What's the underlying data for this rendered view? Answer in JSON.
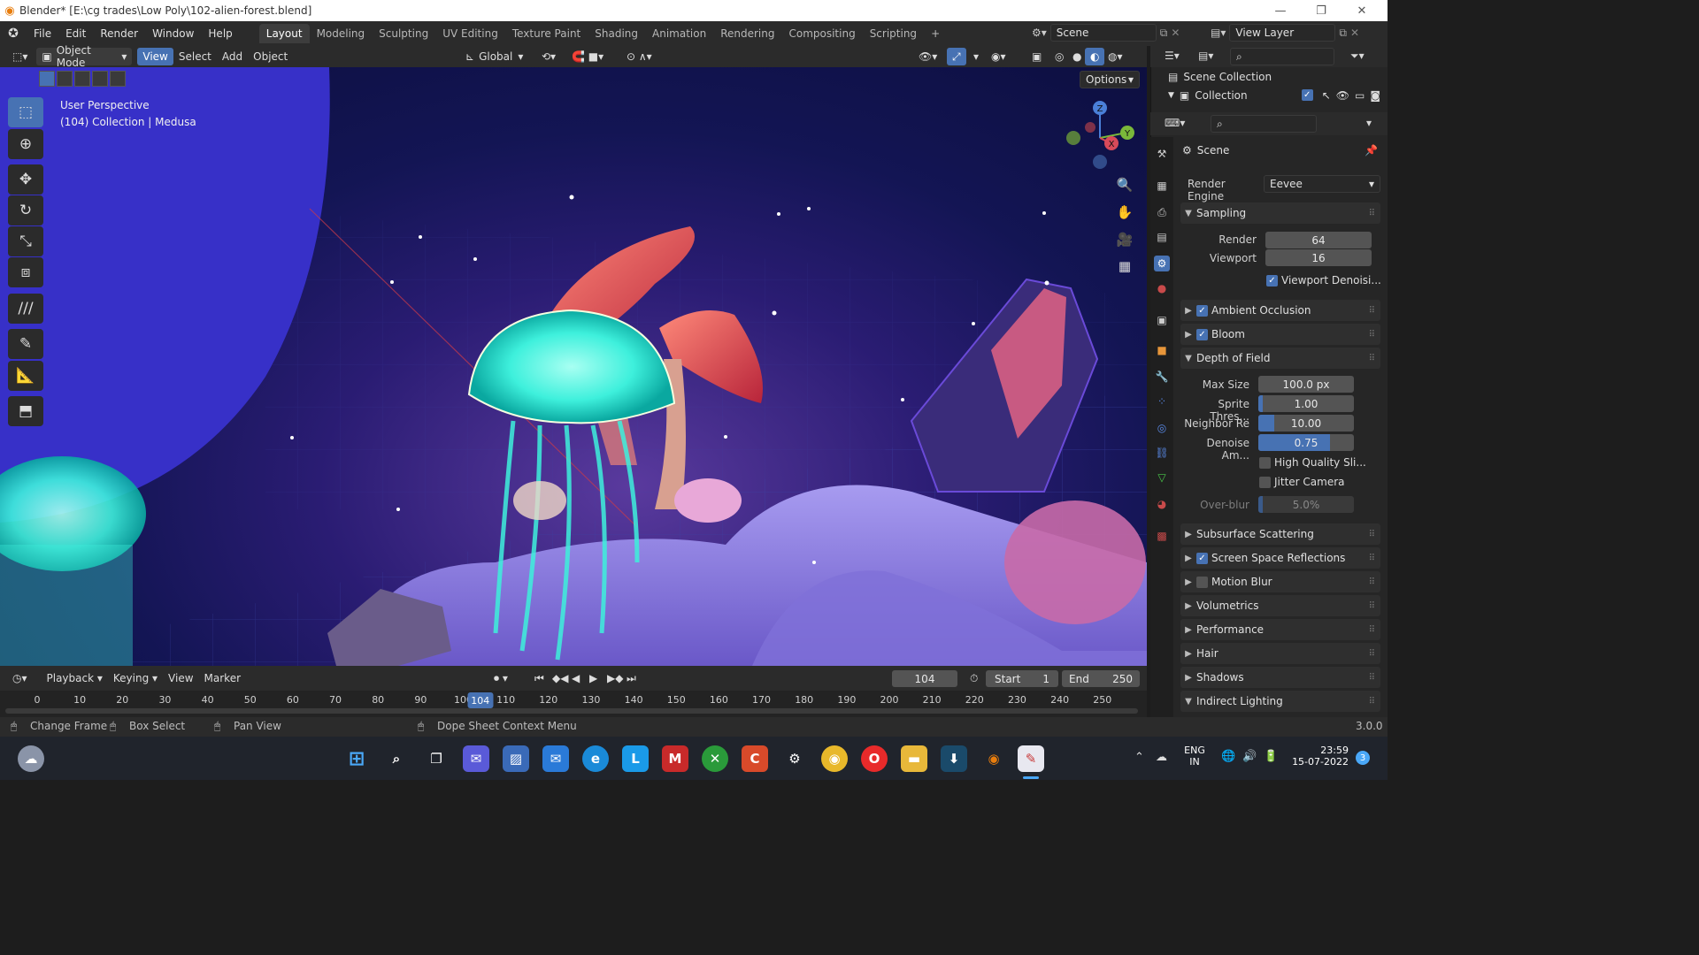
{
  "title_bar": {
    "text": "Blender* [E:\\cg trades\\Low Poly\\102-alien-forest.blend]"
  },
  "menu": {
    "items": [
      "File",
      "Edit",
      "Render",
      "Window",
      "Help"
    ]
  },
  "workspaces": [
    "Layout",
    "Modeling",
    "Sculpting",
    "UV Editing",
    "Texture Paint",
    "Shading",
    "Animation",
    "Rendering",
    "Compositing",
    "Scripting"
  ],
  "scene_selector": {
    "value": "Scene"
  },
  "view_layer_selector": {
    "value": "View Layer"
  },
  "viewport_header": {
    "mode": "Object Mode",
    "menus": [
      "View",
      "Select",
      "Add",
      "Object"
    ],
    "transform_orientation": "Global",
    "options_label": "Options"
  },
  "viewport": {
    "perspective_label": "User Perspective",
    "collection_label": "(104) Collection | Medusa",
    "gizmo_axes": {
      "z": "Z",
      "y": "Y",
      "x": "X"
    }
  },
  "outliner": {
    "items": [
      "Scene Collection",
      "Collection"
    ]
  },
  "properties": {
    "header": "Scene",
    "render_engine_label": "Render Engine",
    "render_engine_value": "Eevee",
    "sampling": {
      "title": "Sampling",
      "render_label": "Render",
      "render_value": "64",
      "viewport_label": "Viewport",
      "viewport_value": "16",
      "denoise_label": "Viewport Denoisi..."
    },
    "ambient_occlusion": "Ambient Occlusion",
    "bloom": "Bloom",
    "depth_of_field": {
      "title": "Depth of Field",
      "max_size_label": "Max Size",
      "max_size_value": "100.0 px",
      "sprite_label": "Sprite Thres...",
      "sprite_value": "1.00",
      "sprite_fill": 0.05,
      "neighbor_label": "Neighbor Re",
      "neighbor_value": "10.00",
      "neighbor_fill": 0.17,
      "denoise_label": "Denoise Am...",
      "denoise_value": "0.75",
      "denoise_fill": 0.75,
      "high_quality_label": "High Quality Sli...",
      "jitter_label": "Jitter Camera",
      "overblur_label": "Over-blur",
      "overblur_value": "5.0%",
      "overblur_fill": 0.05
    },
    "subsurface": "Subsurface Scattering",
    "ssr": "Screen Space Reflections",
    "motion_blur": "Motion Blur",
    "volumetrics": "Volumetrics",
    "performance": "Performance",
    "hair": "Hair",
    "shadows": "Shadows",
    "indirect_lighting": "Indirect Lighting"
  },
  "timeline": {
    "menus": [
      "Playback",
      "Keying",
      "View",
      "Marker"
    ],
    "current_frame": "104",
    "start_label": "Start",
    "start_value": "1",
    "end_label": "End",
    "end_value": "250",
    "ticks": [
      "0",
      "10",
      "20",
      "30",
      "40",
      "50",
      "60",
      "70",
      "80",
      "90",
      "100",
      "110",
      "120",
      "130",
      "140",
      "150",
      "160",
      "170",
      "180",
      "190",
      "200",
      "210",
      "220",
      "230",
      "240",
      "250"
    ],
    "playhead": "104"
  },
  "status_bar": {
    "change_frame": "Change Frame",
    "box_select": "Box Select",
    "pan_view": "Pan View",
    "context_menu": "Dope Sheet Context Menu",
    "version": "3.0.0"
  },
  "taskbar": {
    "lang_top": "ENG",
    "lang_bottom": "IN",
    "time": "23:59",
    "date": "15-07-2022",
    "notifications": "3"
  },
  "colors": {
    "accent": "#4772b3",
    "cyan_glow": "#3ef0dc",
    "viewport_bg": "#131554"
  }
}
